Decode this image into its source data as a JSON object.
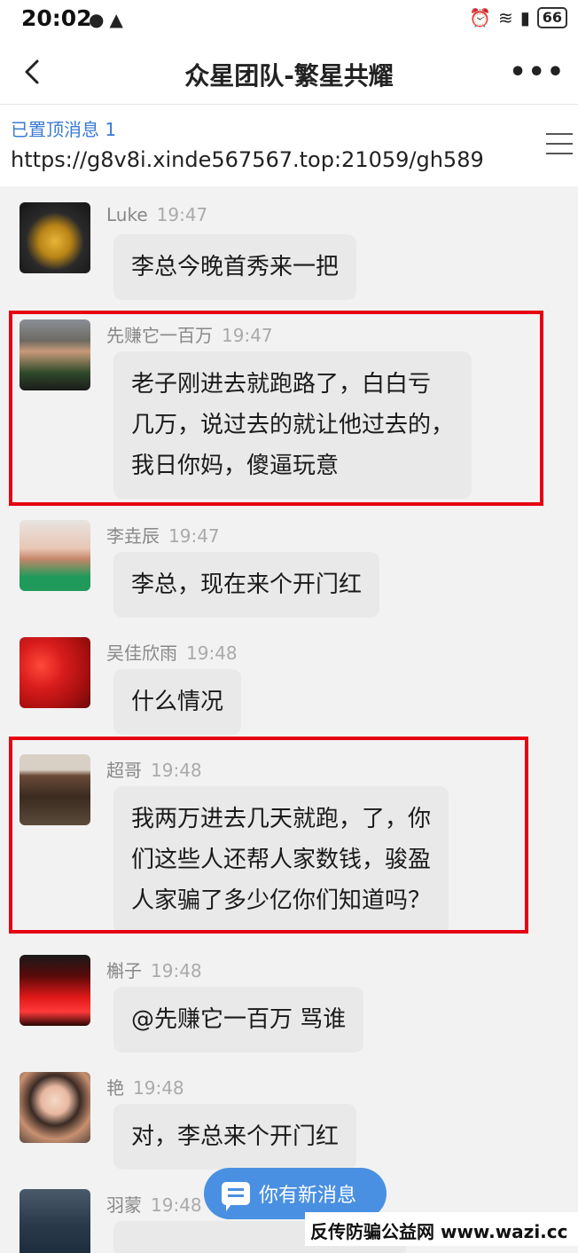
{
  "status_bar": {
    "time": "20:02",
    "battery": "66"
  },
  "header": {
    "title": "众星团队-繁星共耀"
  },
  "pinned": {
    "label": "已置顶消息 1",
    "text": "https://g8v8i.xinde567567.top:21059/gh589"
  },
  "messages": [
    {
      "sender": "Luke",
      "time": "19:47",
      "lines": [
        "李总今晚首秀来一把"
      ]
    },
    {
      "sender": "先赚它一百万",
      "time": "19:47",
      "lines": [
        "老子刚进去就跑路了，白白亏",
        "几万，说过去的就让他过去的，",
        "我日你妈，傻逼玩意"
      ]
    },
    {
      "sender": "李垚辰",
      "time": "19:47",
      "lines": [
        "李总，现在来个开门红"
      ]
    },
    {
      "sender": "吴佳欣雨",
      "time": "19:48",
      "lines": [
        "什么情况"
      ]
    },
    {
      "sender": "超哥",
      "time": "19:48",
      "lines": [
        "我两万进去几天就跑，了，你",
        "们这些人还帮人家数钱，骏盈",
        "人家骗了多少亿你们知道吗？"
      ]
    },
    {
      "sender": "槲子",
      "time": "19:48",
      "lines": [
        "@先赚它一百万 骂谁"
      ]
    },
    {
      "sender": "艳",
      "time": "19:48",
      "lines": [
        "对，李总来个开门红"
      ]
    },
    {
      "sender": "羽蒙",
      "time": "19:48",
      "lines": [
        ""
      ]
    }
  ],
  "new_message_button": {
    "label": "你有新消息"
  },
  "watermark": {
    "text": "反传防骗公益网 www.wazi.cc"
  },
  "colors": {
    "highlight": "#e60012",
    "accent": "#4a90e2",
    "bubble": "#e9e9e9"
  }
}
